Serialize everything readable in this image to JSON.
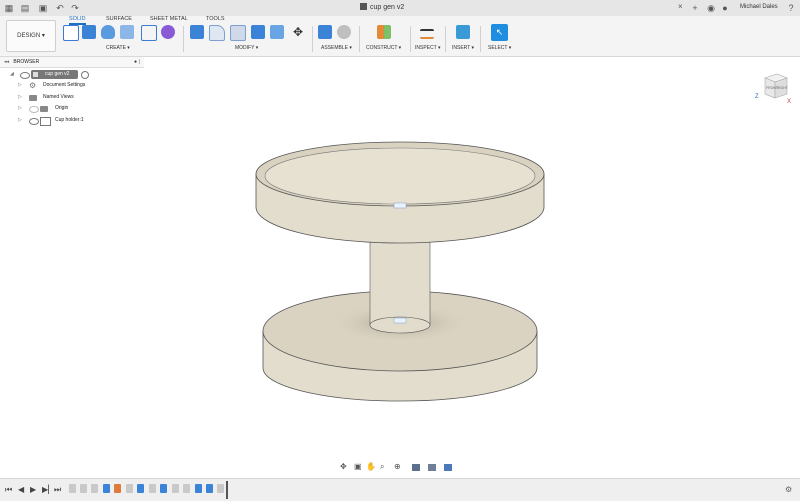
{
  "title_bar": {
    "document_title": "cup gen v2",
    "user_name": "Michael Dales"
  },
  "workspace": {
    "design_label": "DESIGN ▾"
  },
  "tabs": [
    "SOLID",
    "SURFACE",
    "SHEET METAL",
    "TOOLS"
  ],
  "toolbar_groups": {
    "create": "CREATE ▾",
    "modify": "MODIFY ▾",
    "assemble": "ASSEMBLE ▾",
    "construct": "CONSTRUCT ▾",
    "inspect": "INSPECT ▾",
    "insert": "INSERT ▾",
    "select": "SELECT ▾"
  },
  "browser": {
    "header": "BROWSER",
    "items": [
      {
        "label": "cup gen v2"
      },
      {
        "label": "Document Settings"
      },
      {
        "label": "Named Views"
      },
      {
        "label": "Origin"
      },
      {
        "label": "Cup holder:1"
      }
    ]
  },
  "viewcube": {
    "face_front": "FRONT",
    "face_right": "RIGHT",
    "axis_z": "Z",
    "axis_x": "X"
  },
  "colors": {
    "accent": "#1f6fbf",
    "model_body": "#e2dccc",
    "model_shade": "#cfc7b4"
  }
}
